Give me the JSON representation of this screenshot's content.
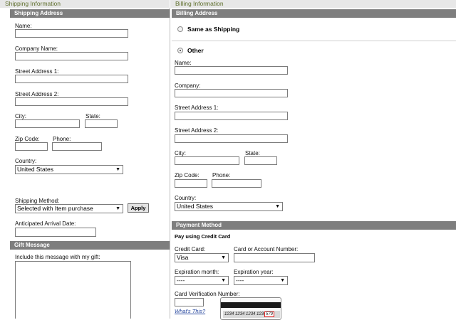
{
  "headers": {
    "shipping_info": "Shipping Information",
    "billing_info": "Billing Information"
  },
  "shipping": {
    "section_title": "Shipping Address",
    "name_label": "Name:",
    "company_label": "Company Name:",
    "street1_label": "Street Address 1:",
    "street2_label": "Street Address 2:",
    "city_label": "City:",
    "state_label": "State:",
    "zip_label": "Zip Code:",
    "phone_label": "Phone:",
    "country_label": "Country:",
    "country_value": "United States",
    "method_label": "Shipping Method:",
    "method_value": "Selected with Item purchase",
    "apply_label": "Apply",
    "arrival_label": "Anticipated Arrival Date:"
  },
  "gift": {
    "section_title": "Gift Message",
    "message_label": "Include this message with my gift:"
  },
  "billing": {
    "section_title": "Billing Address",
    "same_label": "Same as Shipping",
    "other_label": "Other",
    "name_label": "Name:",
    "company_label": "Company:",
    "street1_label": "Street Address 1:",
    "street2_label": "Street Address 2:",
    "city_label": "City:",
    "state_label": "State:",
    "zip_label": "Zip Code:",
    "phone_label": "Phone:",
    "country_label": "Country:",
    "country_value": "United States"
  },
  "payment": {
    "section_title": "Payment Method",
    "subtitle": "Pay using Credit Card",
    "card_label": "Credit Card:",
    "card_value": "Visa",
    "number_label": "Card or Account Number:",
    "exp_month_label": "Expiration month:",
    "exp_month_value": "----",
    "exp_year_label": "Expiration year:",
    "exp_year_value": "----",
    "cvv_label": "Card Verification Number:",
    "whats_this": "What's This?",
    "card_number_sample": "1234 1234 1234 1234",
    "cvv_sample": "579"
  }
}
